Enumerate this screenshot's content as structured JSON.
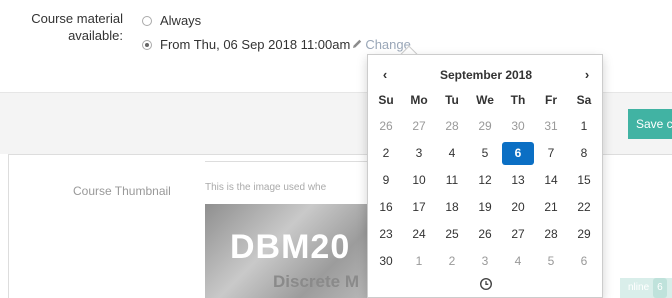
{
  "availability": {
    "label_line1": "Course material",
    "label_line2": "available:",
    "option_always": "Always",
    "option_from": "From Thu, 06 Sep 2018 11:00am",
    "change_link": "Change"
  },
  "toolbar": {
    "save_label": "Save chang"
  },
  "thumbnail": {
    "label": "Course Thumbnail",
    "help_text": "This is the image used whe",
    "image_text_1": "DBM20",
    "image_text_2": "Discrete M"
  },
  "online": {
    "label": "nline",
    "count": "6"
  },
  "datepicker": {
    "prev": "‹",
    "next": "›",
    "month_label": "September 2018",
    "weekdays": [
      "Su",
      "Mo",
      "Tu",
      "We",
      "Th",
      "Fr",
      "Sa"
    ],
    "weeks": [
      [
        "26",
        "27",
        "28",
        "29",
        "30",
        "31",
        "1"
      ],
      [
        "2",
        "3",
        "4",
        "5",
        "6",
        "7",
        "8"
      ],
      [
        "9",
        "10",
        "11",
        "12",
        "13",
        "14",
        "15"
      ],
      [
        "16",
        "17",
        "18",
        "19",
        "20",
        "21",
        "22"
      ],
      [
        "23",
        "24",
        "25",
        "26",
        "27",
        "28",
        "29"
      ],
      [
        "30",
        "1",
        "2",
        "3",
        "4",
        "5",
        "6"
      ]
    ],
    "muted": [
      [
        0,
        0
      ],
      [
        0,
        1
      ],
      [
        0,
        2
      ],
      [
        0,
        3
      ],
      [
        0,
        4
      ],
      [
        0,
        5
      ],
      [
        5,
        1
      ],
      [
        5,
        2
      ],
      [
        5,
        3
      ],
      [
        5,
        4
      ],
      [
        5,
        5
      ],
      [
        5,
        6
      ]
    ],
    "selected": [
      1,
      4
    ],
    "selected_color": "#0b6fc4",
    "time_icon": "clock-icon"
  },
  "colors": {
    "accent": "#41b3a3",
    "link": "#9aa7b8"
  }
}
